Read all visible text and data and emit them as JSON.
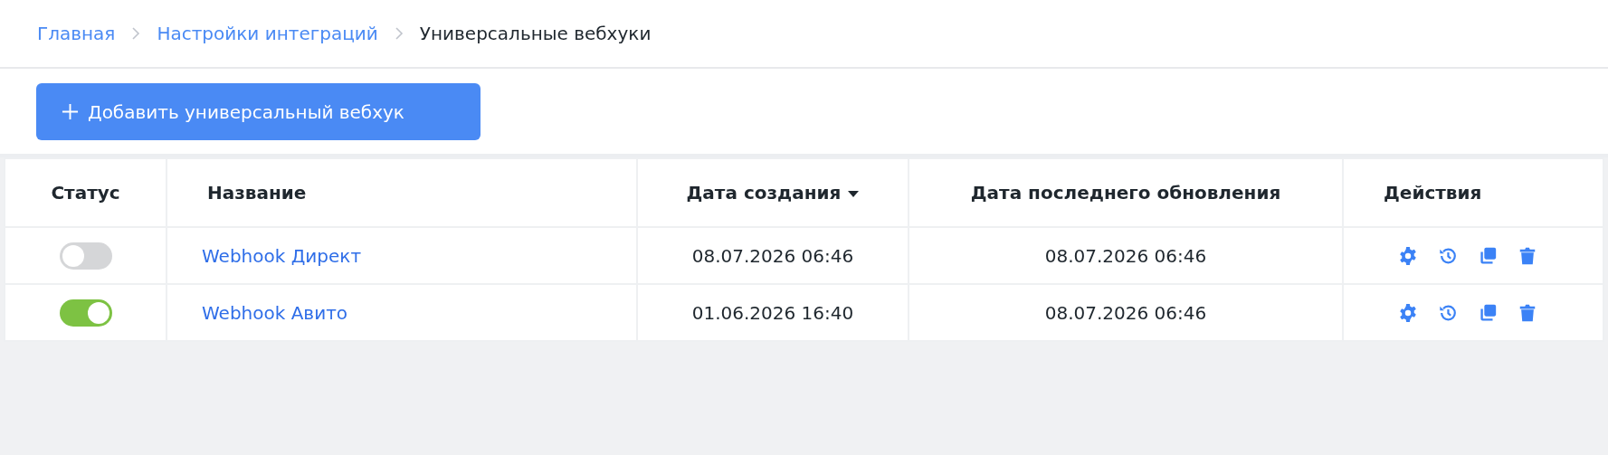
{
  "breadcrumbs": [
    {
      "label": "Главная",
      "current": false
    },
    {
      "label": "Настройки интеграций",
      "current": false
    },
    {
      "label": "Универсальные вебхуки",
      "current": true
    }
  ],
  "add_button": {
    "label": "Добавить универсальный вебхук"
  },
  "table": {
    "columns": [
      {
        "label": "Статус",
        "sorted": false
      },
      {
        "label": "Название",
        "sorted": false
      },
      {
        "label": "Дата создания",
        "sorted": true
      },
      {
        "label": "Дата последнего обновления",
        "sorted": false
      },
      {
        "label": "Действия",
        "sorted": false
      }
    ],
    "rows": [
      {
        "on": false,
        "name": "Webhook Директ",
        "created": "08.07.2026 06:46",
        "updated": "08.07.2026 06:46"
      },
      {
        "on": true,
        "name": "Webhook Авито",
        "created": "01.06.2026 16:40",
        "updated": "08.07.2026 06:46"
      }
    ]
  }
}
